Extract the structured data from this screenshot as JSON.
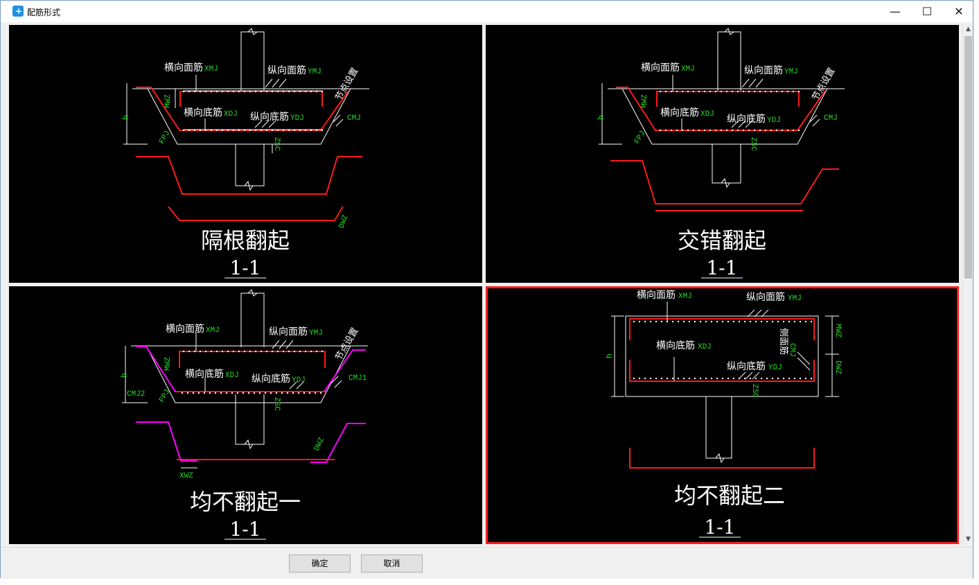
{
  "window": {
    "title": "配筋形式",
    "app_icon": "app-logo-icon"
  },
  "controls": {
    "minimize": "—",
    "maximize": "☐",
    "close": "✕"
  },
  "colors": {
    "rebar": "#ff1a1a",
    "rebar_alt": "#ff00ff",
    "outline": "#ffffff",
    "annotation": "#22dd22",
    "selected_border": "#ff1a1a"
  },
  "panels": [
    {
      "name": "隔根翻起",
      "section": "1-1",
      "labels": {
        "xmj_cn": "横向面筋",
        "xmj": "XMJ",
        "ymj_cn": "纵向面筋",
        "ymj": "YMJ",
        "xdj_cn": "横向底筋",
        "xdj": "XDJ",
        "ydj_cn": "纵向底筋",
        "ydj": "YDJ",
        "node": "节点设置",
        "cmj": "CMJ",
        "mwz": "MWZ",
        "h": "h",
        "fpj": "FPJ",
        "zsc": "ZSC",
        "dwz": "DWZ"
      }
    },
    {
      "name": "交错翻起",
      "section": "1-1",
      "labels": {
        "xmj_cn": "横向面筋",
        "xmj": "XMJ",
        "ymj_cn": "纵向面筋",
        "ymj": "YMJ",
        "xdj_cn": "横向底筋",
        "xdj": "XDJ",
        "ydj_cn": "纵向底筋",
        "ydj": "YDJ",
        "node": "节点设置",
        "cmj": "CMJ",
        "mwz": "MWZ",
        "h": "h",
        "fpj": "FPJ",
        "zsc": "ZSC"
      }
    },
    {
      "name": "均不翻起一",
      "section": "1-1",
      "labels": {
        "xmj_cn": "横向面筋",
        "xmj": "XMJ",
        "ymj_cn": "纵向面筋",
        "ymj": "YMJ",
        "xdj_cn": "横向底筋",
        "xdj": "XDJ",
        "ydj_cn": "纵向底筋",
        "ydj": "YDJ",
        "node": "节点设置",
        "cmj1": "CMJ1",
        "cmj2": "CMJ2",
        "mwz": "MWZ",
        "h": "h",
        "fpj": "FPJ",
        "zsc": "ZSC",
        "dwz": "DWZ",
        "xwz": "XWZ"
      }
    },
    {
      "name": "均不翻起二",
      "section": "1-1",
      "selected": true,
      "labels": {
        "xmj_cn": "横向面筋",
        "xmj": "XMJ",
        "ymj_cn": "纵向面筋",
        "ymj": "YMJ",
        "xdj_cn": "横向底筋",
        "xdj": "XDJ",
        "ydj_cn": "纵向底筋",
        "ydj": "YDJ",
        "side_cn": "侧面筋",
        "cmj": "CMJ",
        "mwz": "MWZ",
        "dwz": "DWZ",
        "h": "h",
        "zsc": "ZSC"
      }
    }
  ],
  "buttons": {
    "ok": "确定",
    "cancel": "取消"
  },
  "scrollbar": {
    "up": "▲",
    "down": "▼"
  }
}
